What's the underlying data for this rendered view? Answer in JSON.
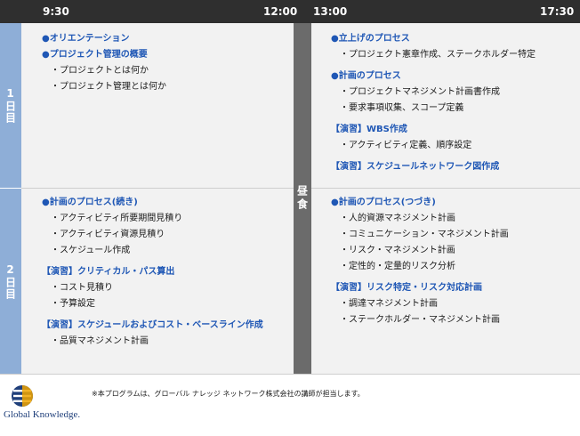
{
  "times": {
    "am_start": "9:30",
    "am_end": "12:00",
    "pm_start": "13:00",
    "pm_end": "17:30"
  },
  "lunch_label": "昼食",
  "days": [
    {
      "label": "1日目",
      "am": [
        {
          "type": "h",
          "text": "●オリエンテーション"
        },
        {
          "type": "h",
          "text": "●プロジェクト管理の概要"
        },
        {
          "type": "s",
          "text": "プロジェクトとは何か"
        },
        {
          "type": "s",
          "text": "プロジェクト管理とは何か"
        }
      ],
      "pm": [
        {
          "type": "h",
          "text": "●立上げのプロセス"
        },
        {
          "type": "s",
          "text": "プロジェクト憲章作成、ステークホルダー特定"
        },
        {
          "type": "h",
          "text": "●計画のプロセス",
          "gap": true
        },
        {
          "type": "s",
          "text": "プロジェクトマネジメント計画書作成"
        },
        {
          "type": "s",
          "text": "要求事項収集、スコープ定義"
        },
        {
          "type": "h",
          "text": "【演習】WBS作成",
          "gap": true
        },
        {
          "type": "s",
          "text": "アクティビティ定義、順序設定"
        },
        {
          "type": "h",
          "text": "【演習】スケジュールネットワーク図作成",
          "gap": true
        }
      ]
    },
    {
      "label": "2日目",
      "am": [
        {
          "type": "h",
          "text": "●計画のプロセス(続き)"
        },
        {
          "type": "s",
          "text": "アクティビティ所要期間見積り"
        },
        {
          "type": "s",
          "text": "アクティビティ資源見積り"
        },
        {
          "type": "s",
          "text": "スケジュール作成"
        },
        {
          "type": "h",
          "text": "【演習】クリティカル・パス算出",
          "gap": true
        },
        {
          "type": "s",
          "text": "コスト見積り"
        },
        {
          "type": "s",
          "text": "予算設定"
        },
        {
          "type": "h",
          "text": "【演習】スケジュールおよびコスト・ベースライン作成",
          "gap": true
        },
        {
          "type": "s",
          "text": "品質マネジメント計画"
        }
      ],
      "pm": [
        {
          "type": "h",
          "text": "●計画のプロセス(つづき)"
        },
        {
          "type": "s",
          "text": "人的資源マネジメント計画"
        },
        {
          "type": "s",
          "text": "コミュニケーション・マネジメント計画"
        },
        {
          "type": "s",
          "text": "リスク・マネジメント計画"
        },
        {
          "type": "s",
          "text": "定性的・定量的リスク分析"
        },
        {
          "type": "h",
          "text": "【演習】リスク特定・リスク対応計画",
          "gap": true
        },
        {
          "type": "s",
          "text": "調達マネジメント計画"
        },
        {
          "type": "s",
          "text": "ステークホルダー・マネジメント計画"
        }
      ]
    }
  ],
  "footnote": "※本プログラムは、グローバル ナレッジ ネットワーク株式会社の講師が担当します。",
  "logo": {
    "text": "Global Knowledge.",
    "icon": "global-knowledge-logo"
  },
  "colors": {
    "header": "#2f2f2f",
    "day_label": "#8eaed7",
    "lunch": "#6b6b6b",
    "heading_text": "#1f57b5",
    "cell_bg": "#f2f2f2"
  }
}
